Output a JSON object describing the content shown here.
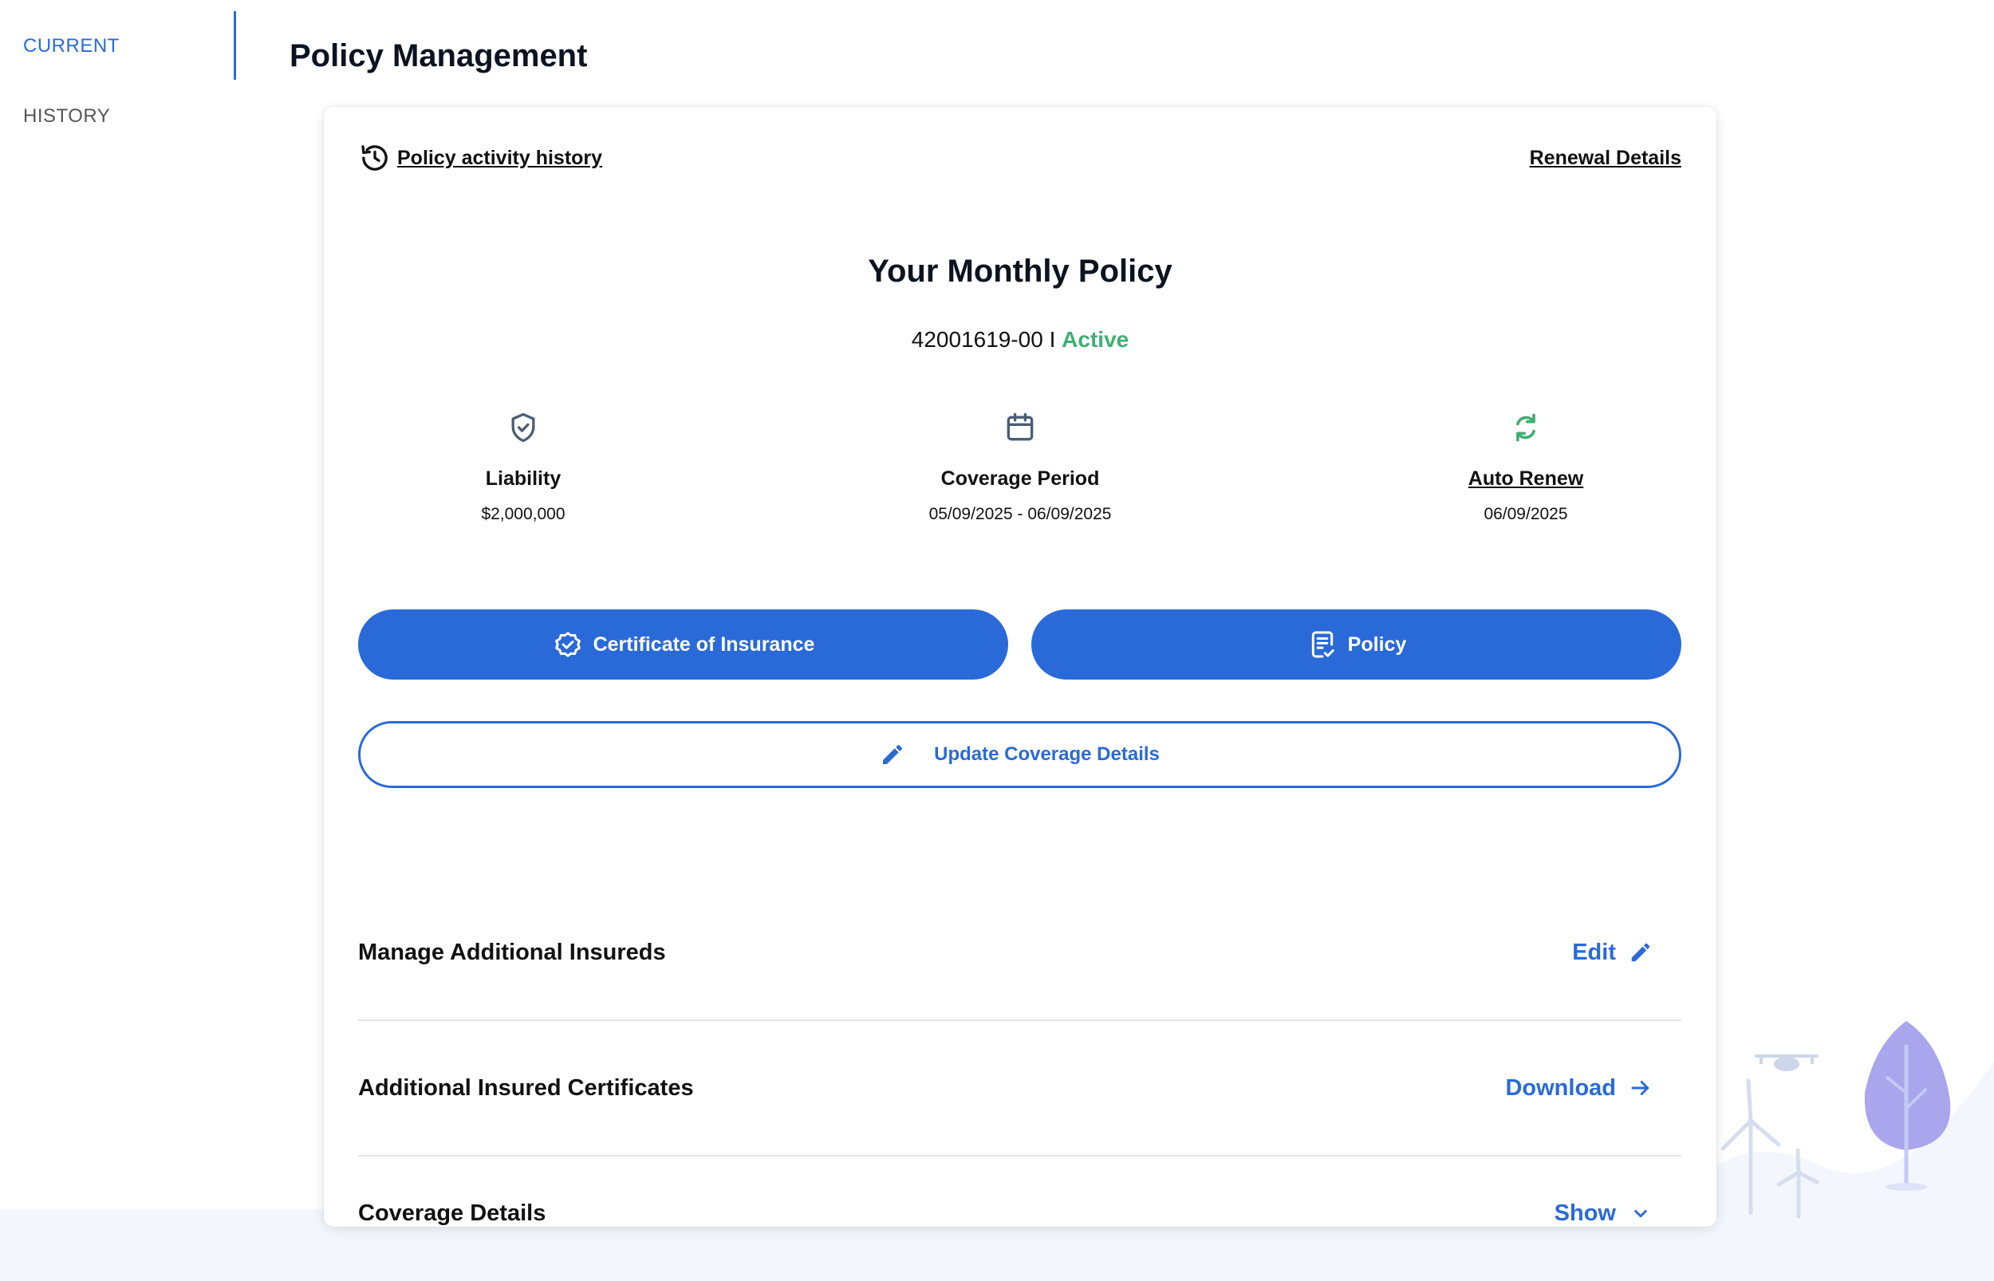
{
  "sidenav": {
    "items": [
      {
        "label": "CURRENT",
        "active": true
      },
      {
        "label": "HISTORY",
        "active": false
      }
    ]
  },
  "page": {
    "title": "Policy Management"
  },
  "card": {
    "activity_link": "Policy activity history",
    "renewal_link": "Renewal Details",
    "heading": "Your Monthly Policy",
    "policy_number": "42001619-00",
    "separator": "I",
    "status": "Active",
    "stats": {
      "liability": {
        "label": "Liability",
        "value": "$2,000,000",
        "icon": "shield-check-icon"
      },
      "coverage": {
        "label": "Coverage Period",
        "value": "05/09/2025 - 06/09/2025",
        "icon": "calendar-icon"
      },
      "renew": {
        "label": "Auto Renew",
        "value": "06/09/2025",
        "icon": "refresh-icon"
      }
    },
    "buttons": {
      "coi": "Certificate of Insurance",
      "policy": "Policy",
      "update": "Update Coverage Details"
    },
    "rows": [
      {
        "title": "Manage Additional Insureds",
        "action": "Edit",
        "icon": "pencil-icon"
      },
      {
        "title": "Additional Insured Certificates",
        "action": "Download",
        "icon": "arrow-right-icon"
      },
      {
        "title": "Coverage Details",
        "action": "Show",
        "icon": "chevron-down-icon"
      }
    ]
  },
  "colors": {
    "accent": "#2a6ad8",
    "status_active": "#3fae72",
    "stat_icon": "#4a5d75"
  }
}
